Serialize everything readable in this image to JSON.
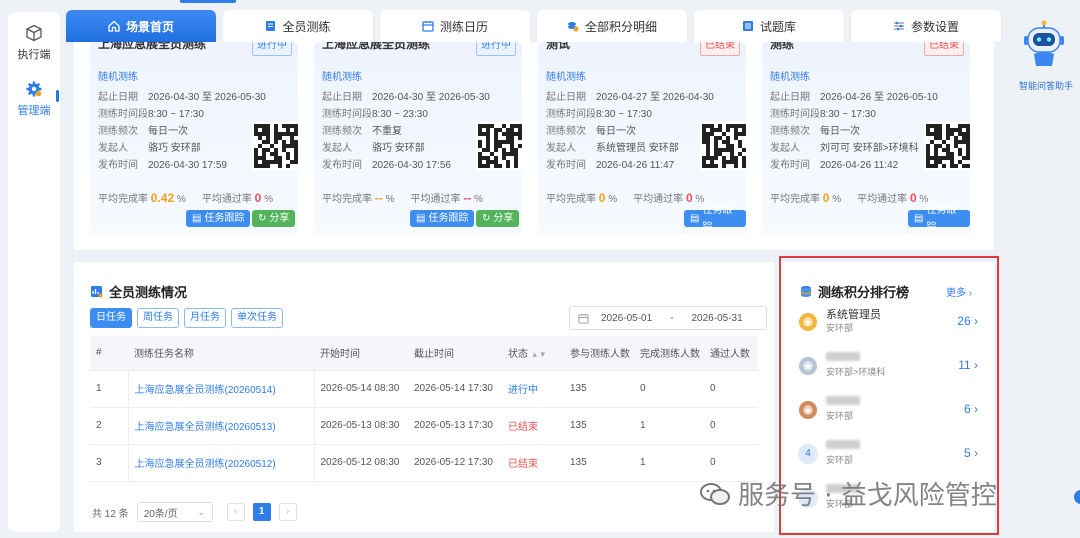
{
  "rail": {
    "items": [
      {
        "label": "执行端",
        "icon": "cube-icon"
      },
      {
        "label": "管理端",
        "icon": "gear-icon"
      }
    ]
  },
  "tabs": [
    {
      "label": "场景首页",
      "icon": "home-icon",
      "active": true
    },
    {
      "label": "全员测练",
      "icon": "book-icon",
      "active": false
    },
    {
      "label": "测练日历",
      "icon": "calendar-icon",
      "active": false
    },
    {
      "label": "全部积分明细",
      "icon": "coins-icon",
      "active": false
    },
    {
      "label": "试题库",
      "icon": "list-icon",
      "active": false
    },
    {
      "label": "参数设置",
      "icon": "sliders-icon",
      "active": false
    }
  ],
  "assistant": {
    "label": "智能问答助手"
  },
  "cards": [
    {
      "title": "上海应急展全员测练",
      "status": "进行中",
      "status_type": "run",
      "type": "随机测练",
      "start_label": "起止日期",
      "start": "2026-04-30",
      "to": "至",
      "end": "2026-05-30",
      "time_label": "测练时间段",
      "time": "8:30 ~ 17:30",
      "freq_label": "测练频次",
      "freq": "每日一次",
      "issuer_label": "发起人",
      "issuer": "骆巧  安环部",
      "pub_label": "发布时间",
      "pub": "2026-04-30 17:59",
      "avg_label": "平均完成率",
      "avg": "0.42",
      "avg_unit": "%",
      "pass_label": "平均通过率",
      "pass": "0",
      "pass_unit": "%",
      "btn_track": "任务跟踪",
      "btn_share": "分享"
    },
    {
      "title": "上海应急展全员测练",
      "status": "进行中",
      "status_type": "run",
      "type": "随机测练",
      "start_label": "起止日期",
      "start": "2026-04-30",
      "to": "至",
      "end": "2026-05-30",
      "time_label": "测练时间段",
      "time": "8:30 ~ 23:30",
      "freq_label": "测练频次",
      "freq": "不重复",
      "issuer_label": "发起人",
      "issuer": "骆巧  安环部",
      "pub_label": "发布时间",
      "pub": "2026-04-30 17:56",
      "avg_label": "平均完成率",
      "avg": "--",
      "avg_unit": "%",
      "pass_label": "平均通过率",
      "pass": "--",
      "pass_unit": "%",
      "btn_track": "任务跟踪",
      "btn_share": "分享"
    },
    {
      "title": "测试",
      "status": "已结束",
      "status_type": "end",
      "type": "随机测练",
      "start_label": "起止日期",
      "start": "2026-04-27",
      "to": "至",
      "end": "2026-04-30",
      "time_label": "测练时间段",
      "time": "8:30 ~ 17:30",
      "freq_label": "测练频次",
      "freq": "每日一次",
      "issuer_label": "发起人",
      "issuer": "系统管理员  安环部",
      "pub_label": "发布时间",
      "pub": "2026-04-26 11:47",
      "avg_label": "平均完成率",
      "avg": "0",
      "avg_unit": "%",
      "pass_label": "平均通过率",
      "pass": "0",
      "pass_unit": "%",
      "btn_track": "任务跟踪",
      "btn_share": ""
    },
    {
      "title": "测练",
      "status": "已结束",
      "status_type": "end",
      "type": "随机测练",
      "start_label": "起止日期",
      "start": "2026-04-26",
      "to": "至",
      "end": "2026-05-10",
      "time_label": "测练时间段",
      "time": "8:30 ~ 17:30",
      "freq_label": "测练频次",
      "freq": "每日一次",
      "issuer_label": "发起人",
      "issuer": "刘可可  安环部>环境科",
      "pub_label": "发布时间",
      "pub": "2026-04-26 11:42",
      "avg_label": "平均完成率",
      "avg": "0",
      "avg_unit": "%",
      "pass_label": "平均通过率",
      "pass": "0",
      "pass_unit": "%",
      "btn_track": "任务跟踪",
      "btn_share": ""
    }
  ],
  "main": {
    "title": "全员测练情况",
    "filters": [
      "日任务",
      "周任务",
      "月任务",
      "单次任务"
    ],
    "date_start": "2026-05-01",
    "date_sep": "-",
    "date_end": "2026-05-31",
    "columns": [
      "#",
      "测练任务名称",
      "开始时间",
      "截止时间",
      "状态",
      "参与测练人数",
      "完成测练人数",
      "通过人数"
    ],
    "rows": [
      {
        "idx": "1",
        "name": "上海应急展全员测练(20260514)",
        "start": "2026-05-14 08:30",
        "end": "2026-05-14 17:30",
        "status": "进行中",
        "status_type": "run",
        "participants": "135",
        "completed": "0",
        "passed": "0"
      },
      {
        "idx": "2",
        "name": "上海应急展全员测练(20260513)",
        "start": "2026-05-13 08:30",
        "end": "2026-05-13 17:30",
        "status": "已结束",
        "status_type": "end",
        "participants": "135",
        "completed": "1",
        "passed": "0"
      },
      {
        "idx": "3",
        "name": "上海应急展全员测练(20260512)",
        "start": "2026-05-12 08:30",
        "end": "2026-05-12 17:30",
        "status": "已结束",
        "status_type": "end",
        "participants": "135",
        "completed": "1",
        "passed": "0"
      }
    ],
    "total": "共 12 条",
    "page_size": "20条/页",
    "current_page": "1"
  },
  "ranking": {
    "title": "测练积分排行榜",
    "more": "更多",
    "items": [
      {
        "name": "系统管理员",
        "dept": "安环部",
        "score": "26",
        "medal": "#f1b43c",
        "rank": ""
      },
      {
        "name": "",
        "dept": "安环部>环境科",
        "score": "11",
        "medal": "#b6c2d6",
        "rank": ""
      },
      {
        "name": "",
        "dept": "安环部",
        "score": "6",
        "medal": "#d28a5c",
        "rank": ""
      },
      {
        "name": "",
        "dept": "安环部",
        "score": "5",
        "medal": "#dfeaf8",
        "rank": "4"
      },
      {
        "name": "",
        "dept": "安环部",
        "score": "",
        "medal": "#dfeaf8",
        "rank": ""
      }
    ]
  },
  "watermark": {
    "text": "服务号 · 益戈风险管控"
  },
  "colors": {
    "accent": "#2f7de9",
    "danger": "#e55353",
    "warning": "#f0a020",
    "success": "#52b45b",
    "highlight_border": "#e23b3b"
  }
}
